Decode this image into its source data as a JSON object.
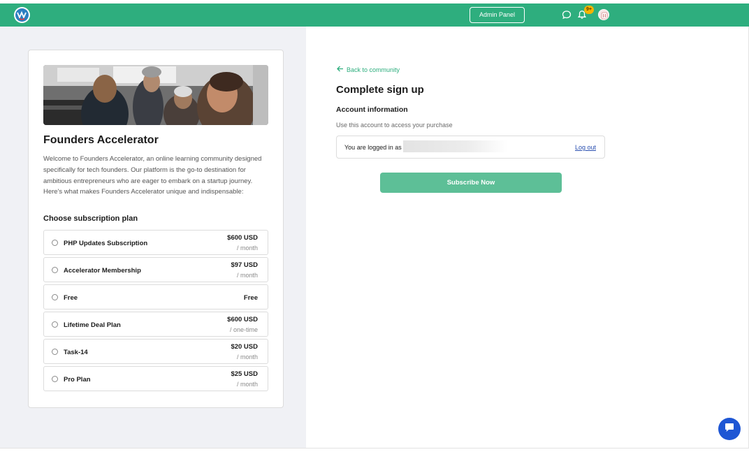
{
  "navbar": {
    "admin_panel_label": "Admin Panel",
    "notification_badge": "9+",
    "icons": {
      "logo": "community-logo",
      "chat": "chat-bubble-icon",
      "bell": "bell-icon",
      "avatar": "user-avatar"
    }
  },
  "community": {
    "title": "Founders Accelerator",
    "description": "Welcome to Founders Accelerator, an online learning community designed specifically for tech founders. Our platform is the go-to destination for ambitious entrepreneurs who are eager to embark on a startup journey. Here's what makes Founders Accelerator unique and indispensable:",
    "plan_heading": "Choose subscription plan",
    "plans": [
      {
        "name": "PHP Updates Subscription",
        "price": "$600 USD",
        "period": "/ month"
      },
      {
        "name": "Accelerator Membership",
        "price": "$97 USD",
        "period": "/ month"
      },
      {
        "name": "Free",
        "price": "Free",
        "period": ""
      },
      {
        "name": "Lifetime Deal Plan",
        "price": "$600 USD",
        "period": "/ one-time"
      },
      {
        "name": "Task-14",
        "price": "$20 USD",
        "period": "/ month"
      },
      {
        "name": "Pro Plan",
        "price": "$25 USD",
        "period": "/ month"
      }
    ]
  },
  "signup": {
    "back_link": "Back to community",
    "title": "Complete sign up",
    "account_heading": "Account information",
    "account_subtext": "Use this account to access your purchase",
    "logged_in_text": "You are logged in as",
    "logout_label": "Log out",
    "subscribe_label": "Subscribe Now"
  },
  "colors": {
    "brand_green": "#2eae7e",
    "button_green": "#5dbf97",
    "chat_blue": "#1e56d4",
    "badge_yellow": "#f5b400"
  }
}
